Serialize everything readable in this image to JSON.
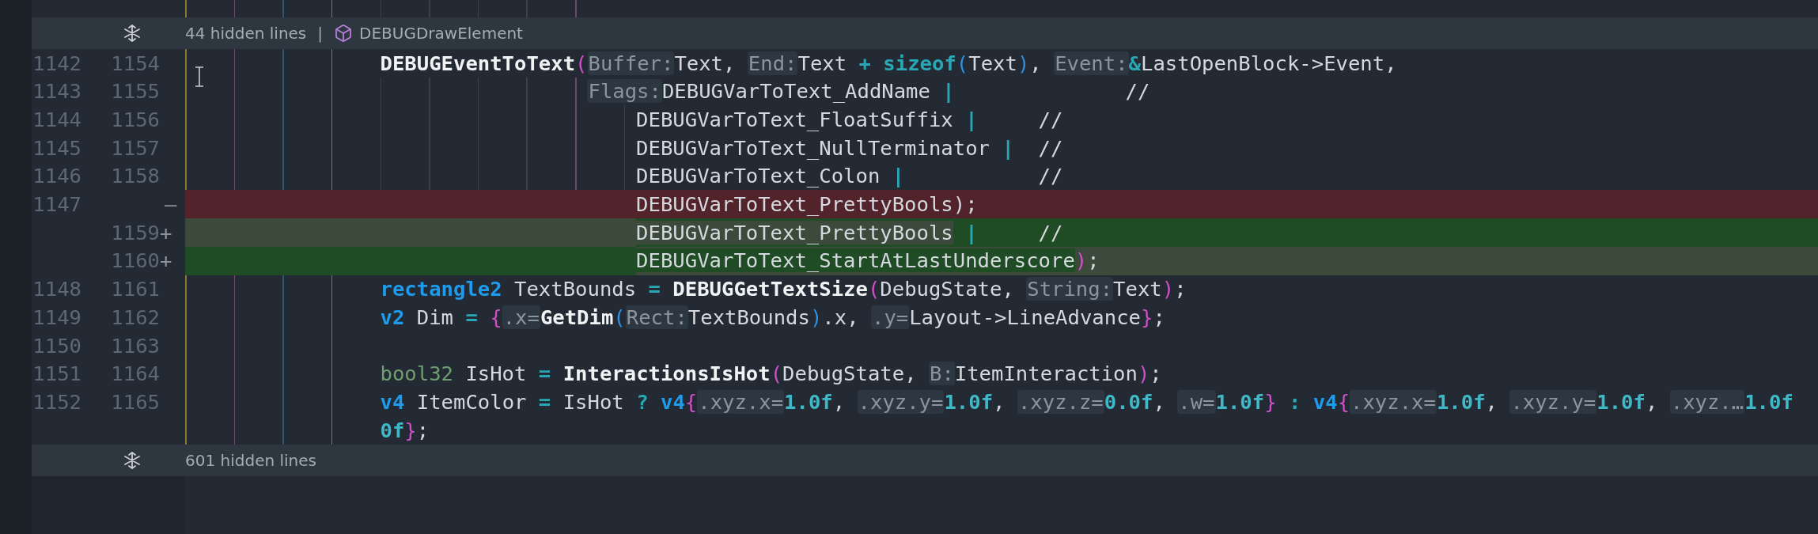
{
  "blocks": [
    {
      "kind": "fold",
      "label": "44 hidden lines",
      "separator": "|",
      "symbol": "DEBUGDrawElement"
    },
    {
      "kind": "body",
      "old": "1142",
      "new": "1154",
      "removed": false,
      "added": false,
      "segments": [
        {
          "kind": "bold",
          "text": "DEBUGEventToText"
        },
        {
          "kind": "paren_pink",
          "text": "("
        },
        {
          "kind": "hint",
          "text": "Buffer:"
        },
        {
          "kind": "plain",
          "text": "Text, "
        },
        {
          "kind": "hint",
          "text": "End:"
        },
        {
          "kind": "plain",
          "text": "Text "
        },
        {
          "kind": "op",
          "text": "+"
        },
        {
          "kind": "keyword",
          "text": " sizeof"
        },
        {
          "kind": "paren_blue",
          "text": "("
        },
        {
          "kind": "plain",
          "text": "Text"
        },
        {
          "kind": "paren_blue",
          "text": ")"
        },
        {
          "kind": "plain",
          "text": ", "
        },
        {
          "kind": "hint",
          "text": "Event:"
        },
        {
          "kind": "op",
          "text": "&"
        },
        {
          "kind": "plain",
          "text": "LastOpenBlock->Event,"
        }
      ]
    },
    {
      "kind": "args",
      "old": "1143",
      "new": "1155",
      "removed": false,
      "added": false,
      "segments": [
        {
          "kind": "hint",
          "text": "Flags:"
        },
        {
          "kind": "plain",
          "text": "DEBUGVarToText_AddName "
        },
        {
          "kind": "op",
          "text": "|"
        },
        {
          "kind": "plain",
          "text": "              //"
        }
      ]
    },
    {
      "kind": "flags",
      "old": "1144",
      "new": "1156",
      "removed": false,
      "added": false,
      "segments": [
        {
          "kind": "plain",
          "text": "DEBUGVarToText_FloatSuffix "
        },
        {
          "kind": "op",
          "text": "|"
        },
        {
          "kind": "plain",
          "text": "     //"
        }
      ]
    },
    {
      "kind": "flags",
      "old": "1145",
      "new": "1157",
      "removed": false,
      "added": false,
      "segments": [
        {
          "kind": "plain",
          "text": "DEBUGVarToText_NullTerminator "
        },
        {
          "kind": "op",
          "text": "|"
        },
        {
          "kind": "plain",
          "text": "  //"
        }
      ]
    },
    {
      "kind": "flags",
      "old": "1146",
      "new": "1158",
      "removed": false,
      "added": false,
      "segments": [
        {
          "kind": "plain",
          "text": "DEBUGVarToText_Colon "
        },
        {
          "kind": "op",
          "text": "|"
        },
        {
          "kind": "plain",
          "text": "           //"
        }
      ]
    },
    {
      "kind": "flags",
      "old": "1147",
      "marker": "—",
      "removed": true,
      "added": false,
      "segments": [
        {
          "kind": "plain",
          "text": "DEBUGVarToText_PrettyBools);"
        }
      ]
    },
    {
      "kind": "flags",
      "new": "1159",
      "marker": "+",
      "removed": false,
      "added": true,
      "tail_changed": true,
      "segments": [
        {
          "kind": "plain",
          "text": "DEBUGVarToText_PrettyBools",
          "changed": false
        },
        {
          "kind": "op",
          "text": " |",
          "changed": true
        },
        {
          "kind": "plain",
          "text": "     //",
          "changed": true
        }
      ]
    },
    {
      "kind": "flags",
      "new": "1160",
      "marker": "+",
      "removed": false,
      "added": true,
      "tail_changed": false,
      "segments": [
        {
          "kind": "plain",
          "text": "DEBUGVarToText_StartAtLastUnderscore",
          "changed": true
        },
        {
          "kind": "paren_pink",
          "text": ")",
          "changed": false
        },
        {
          "kind": "plain",
          "text": ";",
          "changed": false
        }
      ]
    },
    {
      "kind": "body",
      "old": "1148",
      "new": "1161",
      "removed": false,
      "added": false,
      "segments": [
        {
          "kind": "type",
          "text": "rectangle2"
        },
        {
          "kind": "plain",
          "text": " TextBounds "
        },
        {
          "kind": "op",
          "text": "="
        },
        {
          "kind": "bold",
          "text": " DEBUGGetTextSize"
        },
        {
          "kind": "paren_pink",
          "text": "("
        },
        {
          "kind": "plain",
          "text": "DebugState, "
        },
        {
          "kind": "hint",
          "text": "String:"
        },
        {
          "kind": "plain",
          "text": "Text"
        },
        {
          "kind": "paren_pink",
          "text": ")"
        },
        {
          "kind": "plain",
          "text": ";"
        }
      ]
    },
    {
      "kind": "body",
      "old": "1149",
      "new": "1162",
      "removed": false,
      "added": false,
      "segments": [
        {
          "kind": "type",
          "text": "v2"
        },
        {
          "kind": "plain",
          "text": " Dim "
        },
        {
          "kind": "op",
          "text": "="
        },
        {
          "kind": "paren_pink",
          "text": " {"
        },
        {
          "kind": "hint",
          "text": ".x="
        },
        {
          "kind": "bold",
          "text": "GetDim"
        },
        {
          "kind": "paren_blue",
          "text": "("
        },
        {
          "kind": "hint",
          "text": "Rect:"
        },
        {
          "kind": "plain",
          "text": "TextBounds"
        },
        {
          "kind": "paren_blue",
          "text": ")"
        },
        {
          "kind": "plain",
          "text": ".x, "
        },
        {
          "kind": "hint",
          "text": ".y="
        },
        {
          "kind": "plain",
          "text": "Layout->LineAdvance"
        },
        {
          "kind": "paren_pink",
          "text": "}"
        },
        {
          "kind": "plain",
          "text": ";"
        }
      ]
    },
    {
      "kind": "body",
      "old": "1150",
      "new": "1163",
      "removed": false,
      "added": false
    },
    {
      "kind": "body",
      "old": "1151",
      "new": "1164",
      "removed": false,
      "added": false,
      "segments": [
        {
          "kind": "type2",
          "text": "bool32"
        },
        {
          "kind": "plain",
          "text": " IsHot "
        },
        {
          "kind": "op",
          "text": "="
        },
        {
          "kind": "bold",
          "text": " InteractionsIsHot"
        },
        {
          "kind": "paren_pink",
          "text": "("
        },
        {
          "kind": "plain",
          "text": "DebugState, "
        },
        {
          "kind": "hint",
          "text": "B:"
        },
        {
          "kind": "plain",
          "text": "ItemInteraction"
        },
        {
          "kind": "paren_pink",
          "text": ")"
        },
        {
          "kind": "plain",
          "text": ";"
        }
      ]
    },
    {
      "kind": "body",
      "old": "1152",
      "new": "1165",
      "removed": false,
      "added": false,
      "segments": [
        {
          "kind": "type",
          "text": "v4"
        },
        {
          "kind": "plain",
          "text": " ItemColor "
        },
        {
          "kind": "op",
          "text": "="
        },
        {
          "kind": "plain",
          "text": " IsHot "
        },
        {
          "kind": "op",
          "text": "?"
        },
        {
          "kind": "type",
          "text": " v4"
        },
        {
          "kind": "paren_pink",
          "text": "{"
        },
        {
          "kind": "hint",
          "text": ".xyz.x="
        },
        {
          "kind": "num",
          "text": "1.0f"
        },
        {
          "kind": "plain",
          "text": ", "
        },
        {
          "kind": "hint",
          "text": ".xyz.y="
        },
        {
          "kind": "num",
          "text": "1.0f"
        },
        {
          "kind": "plain",
          "text": ", "
        },
        {
          "kind": "hint",
          "text": ".xyz.z="
        },
        {
          "kind": "num",
          "text": "0.0f"
        },
        {
          "kind": "plain",
          "text": ", "
        },
        {
          "kind": "hint",
          "text": ".w="
        },
        {
          "kind": "num",
          "text": "1.0f"
        },
        {
          "kind": "paren_pink",
          "text": "}"
        },
        {
          "kind": "op",
          "text": " :"
        },
        {
          "kind": "type",
          "text": " v4"
        },
        {
          "kind": "paren_pink",
          "text": "{"
        },
        {
          "kind": "hint",
          "text": ".xyz.x="
        },
        {
          "kind": "num",
          "text": "1.0f"
        },
        {
          "kind": "plain",
          "text": ", "
        },
        {
          "kind": "hint",
          "text": ".xyz.y="
        },
        {
          "kind": "num",
          "text": "1.0f"
        },
        {
          "kind": "plain",
          "text": ", "
        },
        {
          "kind": "hint",
          "text": ".xyz.…"
        },
        {
          "kind": "num",
          "text": "1.0f"
        }
      ]
    },
    {
      "kind": "body",
      "removed": false,
      "added": false,
      "segments": [
        {
          "kind": "num",
          "text": "0f"
        },
        {
          "kind": "paren_pink",
          "text": "}"
        },
        {
          "kind": "plain",
          "text": ";"
        }
      ]
    },
    {
      "kind": "fold",
      "label": "601 hidden lines"
    }
  ]
}
